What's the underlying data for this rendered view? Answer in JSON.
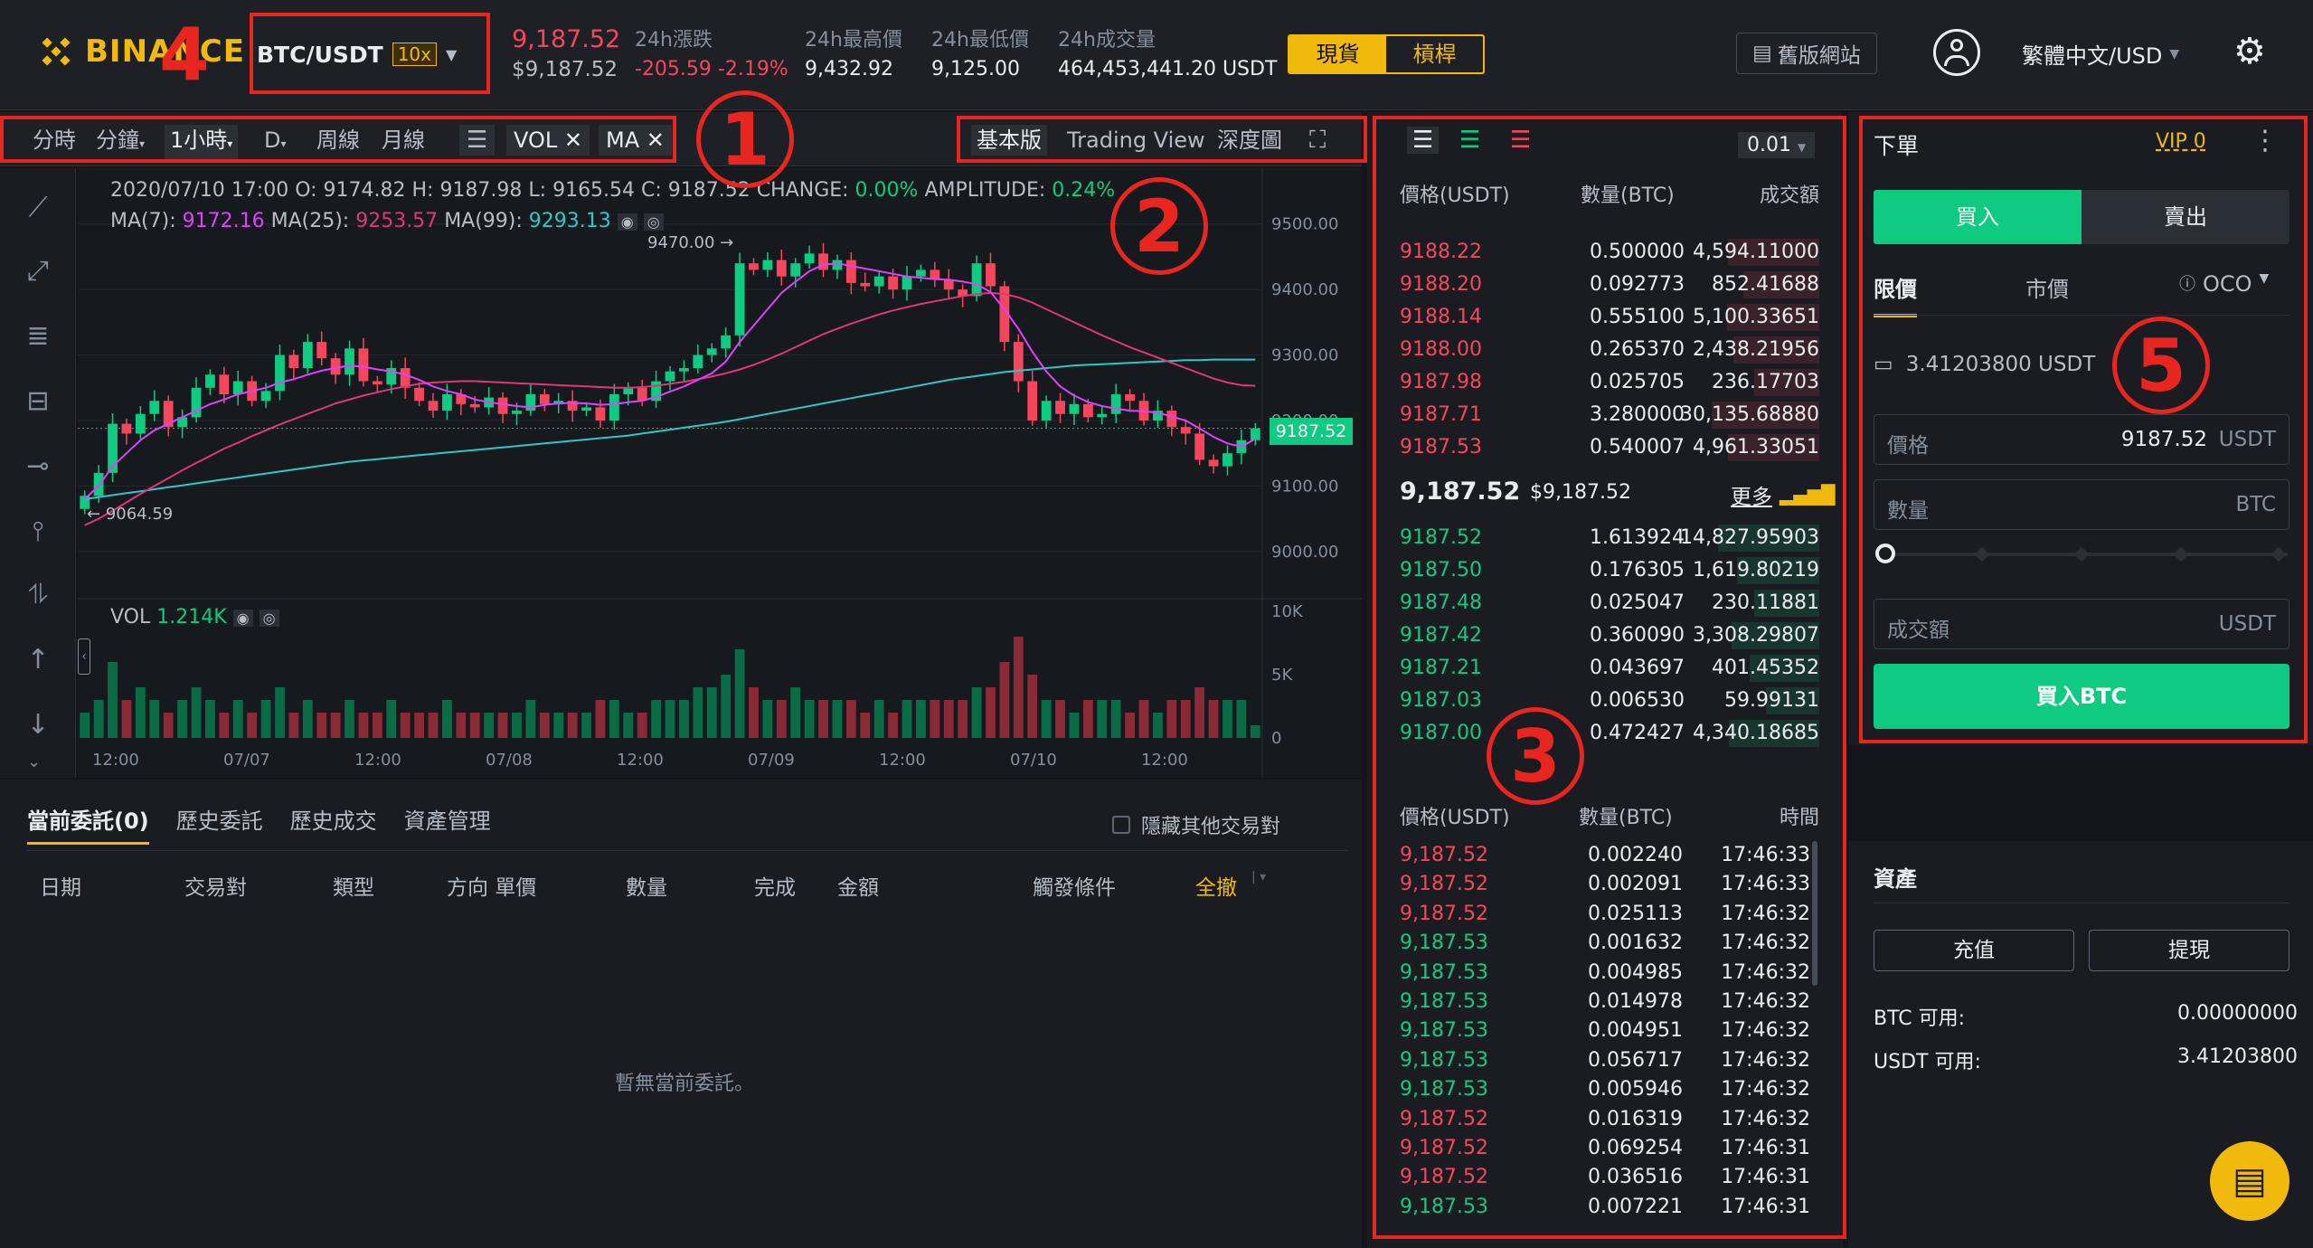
{
  "header": {
    "logo_text": "BINANCE",
    "pair": "BTC/USDT",
    "leverage": "10x",
    "last_price": "9,187.52",
    "last_price_usd": "$9,187.52",
    "change_label": "24h漲跌",
    "change_value": "-205.59 -2.19%",
    "high_label": "24h最高價",
    "high_value": "9,432.92",
    "low_label": "24h最低價",
    "low_value": "9,125.00",
    "volume_label": "24h成交量",
    "volume_value": "464,453,441.20 USDT",
    "spot_label": "現貨",
    "margin_label": "槓桿",
    "classic_label": "舊版網站",
    "language": "繁體中文/USD"
  },
  "chart_toolbar": {
    "items": [
      "分時",
      "分鐘",
      "1小時",
      "D",
      "周線",
      "月線"
    ],
    "vol_label": "VOL",
    "ma_label": "MA",
    "views": [
      "基本版",
      "Trading View",
      "深度圖"
    ]
  },
  "chart_info": {
    "ohlc_line": "2020/07/10 17:00  O: 9174.82  H: 9187.98  L: 9165.54  C: 9187.52",
    "change_text": "CHANGE: ",
    "change_val": "0.00%",
    "amp_text": "AMPLITUDE: ",
    "amp_val": "0.24%",
    "ma7_label": "MA(7):",
    "ma7_val": "9172.16",
    "ma25_label": "MA(25):",
    "ma25_val": "9253.57",
    "ma99_label": "MA(99):",
    "ma99_val": "9293.13",
    "high_marker": "9470.00",
    "low_marker": "9064.59",
    "current_price_tag": "9187.52",
    "vol_label": "VOL",
    "vol_val": "1.214K"
  },
  "chart_data": {
    "type": "candlestick",
    "y_ticks": [
      "9500.00",
      "9400.00",
      "9300.00",
      "9200.00",
      "9100.00",
      "9000.00"
    ],
    "ylim": [
      8950,
      9530
    ],
    "vol_ticks": [
      "10K",
      "5K",
      "0"
    ],
    "x_ticks": [
      "12:00",
      "07/07",
      "12:00",
      "07/08",
      "12:00",
      "07/09",
      "12:00",
      "07/10",
      "12:00"
    ],
    "closes": [
      9085,
      9120,
      9195,
      9180,
      9210,
      9230,
      9190,
      9205,
      9250,
      9270,
      9240,
      9260,
      9230,
      9245,
      9300,
      9280,
      9320,
      9295,
      9270,
      9310,
      9260,
      9255,
      9280,
      9250,
      9230,
      9215,
      9240,
      9225,
      9220,
      9235,
      9210,
      9215,
      9240,
      9225,
      9230,
      9215,
      9220,
      9200,
      9240,
      9250,
      9230,
      9260,
      9275,
      9280,
      9300,
      9310,
      9330,
      9440,
      9430,
      9445,
      9420,
      9440,
      9455,
      9430,
      9445,
      9410,
      9405,
      9420,
      9400,
      9420,
      9430,
      9415,
      9400,
      9390,
      9440,
      9405,
      9320,
      9260,
      9200,
      9230,
      9210,
      9225,
      9205,
      9210,
      9240,
      9230,
      9200,
      9215,
      9190,
      9180,
      9140,
      9130,
      9150,
      9170,
      9188
    ],
    "ma7": [
      9080,
      9100,
      9130,
      9150,
      9170,
      9185,
      9195,
      9205,
      9215,
      9225,
      9232,
      9240,
      9245,
      9250,
      9258,
      9263,
      9270,
      9276,
      9280,
      9284,
      9282,
      9278,
      9275,
      9270,
      9262,
      9252,
      9245,
      9240,
      9232,
      9228,
      9225,
      9222,
      9220,
      9224,
      9226,
      9227,
      9226,
      9224,
      9225,
      9228,
      9230,
      9236,
      9244,
      9252,
      9262,
      9272,
      9290,
      9320,
      9345,
      9370,
      9395,
      9412,
      9428,
      9438,
      9440,
      9436,
      9432,
      9428,
      9424,
      9420,
      9418,
      9416,
      9415,
      9412,
      9408,
      9396,
      9370,
      9340,
      9305,
      9275,
      9252,
      9238,
      9228,
      9222,
      9218,
      9215,
      9214,
      9212,
      9206,
      9200,
      9188,
      9175,
      9165,
      9160,
      9172
    ],
    "ma25": [
      9040,
      9050,
      9062,
      9075,
      9088,
      9100,
      9112,
      9124,
      9135,
      9146,
      9157,
      9166,
      9176,
      9185,
      9194,
      9202,
      9210,
      9218,
      9226,
      9232,
      9238,
      9243,
      9248,
      9252,
      9256,
      9258,
      9259,
      9260,
      9260,
      9259,
      9258,
      9257,
      9256,
      9255,
      9254,
      9253,
      9252,
      9251,
      9250,
      9250,
      9251,
      9253,
      9256,
      9259,
      9263,
      9267,
      9272,
      9278,
      9285,
      9293,
      9302,
      9312,
      9322,
      9332,
      9340,
      9348,
      9355,
      9362,
      9368,
      9373,
      9378,
      9382,
      9386,
      9390,
      9393,
      9395,
      9393,
      9388,
      9380,
      9370,
      9360,
      9350,
      9340,
      9330,
      9321,
      9312,
      9304,
      9296,
      9288,
      9280,
      9272,
      9264,
      9258,
      9254,
      9253
    ],
    "ma99": [
      9080,
      9083,
      9086,
      9089,
      9092,
      9095,
      9098,
      9101,
      9104,
      9107,
      9110,
      9113,
      9116,
      9119,
      9122,
      9125,
      9128,
      9131,
      9134,
      9137,
      9139,
      9141,
      9143,
      9145,
      9147,
      9149,
      9151,
      9153,
      9155,
      9157,
      9159,
      9161,
      9163,
      9165,
      9167,
      9169,
      9171,
      9173,
      9175,
      9177,
      9180,
      9183,
      9186,
      9189,
      9192,
      9195,
      9198,
      9202,
      9206,
      9210,
      9214,
      9218,
      9222,
      9226,
      9230,
      9234,
      9238,
      9242,
      9246,
      9250,
      9254,
      9258,
      9262,
      9265,
      9268,
      9271,
      9274,
      9276,
      9278,
      9280,
      9282,
      9284,
      9285,
      9286,
      9287,
      9288,
      9289,
      9290,
      9291,
      9292,
      9292,
      9293,
      9293,
      9293,
      9293
    ],
    "volumes": [
      2,
      3,
      6,
      3,
      4,
      3,
      2,
      3,
      4,
      3,
      2,
      3,
      2,
      3,
      4,
      2,
      3,
      2,
      2,
      3,
      2,
      2,
      3,
      2,
      2,
      2,
      3,
      2,
      2,
      2,
      2,
      2,
      3,
      2,
      2,
      2,
      2,
      3,
      3,
      2,
      2,
      3,
      3,
      3,
      4,
      4,
      5,
      7,
      4,
      3,
      3,
      4,
      3,
      3,
      3,
      3,
      2,
      3,
      2,
      3,
      3,
      3,
      3,
      3,
      4,
      4,
      6,
      8,
      5,
      3,
      3,
      2,
      3,
      3,
      3,
      2,
      3,
      2,
      3,
      3,
      4,
      3,
      3,
      3,
      1
    ]
  },
  "left_tools": [
    "trend-line-icon",
    "ray-icon",
    "fib-icon",
    "pattern-icon",
    "horizontal-line-icon",
    "vertical-line-icon",
    "path-icon",
    "arrow-up-icon",
    "arrow-down-icon"
  ],
  "orders": {
    "tabs": [
      "當前委託(0)",
      "歷史委託",
      "歷史成交",
      "資產管理"
    ],
    "hide_other": "隱藏其他交易對",
    "columns": [
      "日期",
      "交易對",
      "類型",
      "方向 單價",
      "數量",
      "完成",
      "金額",
      "觸發條件"
    ],
    "cancel_all": "全撤",
    "empty": "暫無當前委託。"
  },
  "orderbook": {
    "precision": "0.01",
    "headers": [
      "價格(USDT)",
      "數量(BTC)",
      "成交額"
    ],
    "asks": [
      [
        "9188.22",
        "0.500000",
        "4,594.11000"
      ],
      [
        "9188.20",
        "0.092773",
        "852.41688"
      ],
      [
        "9188.14",
        "0.555100",
        "5,100.33651"
      ],
      [
        "9188.00",
        "0.265370",
        "2,438.21956"
      ],
      [
        "9187.98",
        "0.025705",
        "236.17703"
      ],
      [
        "9187.71",
        "3.280000",
        "30,135.68880"
      ],
      [
        "9187.53",
        "0.540007",
        "4,961.33051"
      ]
    ],
    "mid_price": "9,187.52",
    "mid_usd": "$9,187.52",
    "more": "更多",
    "bids": [
      [
        "9187.52",
        "1.613924",
        "14,827.95903"
      ],
      [
        "9187.50",
        "0.176305",
        "1,619.80219"
      ],
      [
        "9187.48",
        "0.025047",
        "230.11881"
      ],
      [
        "9187.42",
        "0.360090",
        "3,308.29807"
      ],
      [
        "9187.21",
        "0.043697",
        "401.45352"
      ],
      [
        "9187.03",
        "0.006530",
        "59.99131"
      ],
      [
        "9187.00",
        "0.472427",
        "4,340.18685"
      ]
    ]
  },
  "trades": {
    "headers": [
      "價格(USDT)",
      "數量(BTC)",
      "時間"
    ],
    "rows": [
      [
        "9,187.52",
        "0.002240",
        "17:46:33",
        "sell"
      ],
      [
        "9,187.52",
        "0.002091",
        "17:46:33",
        "sell"
      ],
      [
        "9,187.52",
        "0.025113",
        "17:46:32",
        "sell"
      ],
      [
        "9,187.53",
        "0.001632",
        "17:46:32",
        "buy"
      ],
      [
        "9,187.53",
        "0.004985",
        "17:46:32",
        "buy"
      ],
      [
        "9,187.53",
        "0.014978",
        "17:46:32",
        "buy"
      ],
      [
        "9,187.53",
        "0.004951",
        "17:46:32",
        "buy"
      ],
      [
        "9,187.53",
        "0.056717",
        "17:46:32",
        "buy"
      ],
      [
        "9,187.53",
        "0.005946",
        "17:46:32",
        "buy"
      ],
      [
        "9,187.52",
        "0.016319",
        "17:46:32",
        "sell"
      ],
      [
        "9,187.52",
        "0.069254",
        "17:46:31",
        "sell"
      ],
      [
        "9,187.52",
        "0.036516",
        "17:46:31",
        "sell"
      ],
      [
        "9,187.53",
        "0.007221",
        "17:46:31",
        "buy"
      ]
    ]
  },
  "order_form": {
    "title": "下單",
    "vip": "VIP 0",
    "buy_tab": "買入",
    "sell_tab": "賣出",
    "type_tabs": [
      "限價",
      "市價",
      "OCO"
    ],
    "balance": "3.41203800 USDT",
    "price_label": "價格",
    "price_value": "9187.52",
    "price_unit": "USDT",
    "amount_label": "數量",
    "amount_unit": "BTC",
    "total_label": "成交額",
    "total_unit": "USDT",
    "submit": "買入BTC"
  },
  "assets": {
    "title": "資產",
    "deposit": "充值",
    "withdraw": "提現",
    "btc_label": "BTC 可用:",
    "btc_value": "0.00000000",
    "usdt_label": "USDT 可用:",
    "usdt_value": "3.41203800"
  },
  "annotations": [
    "1",
    "2",
    "3",
    "4",
    "5"
  ],
  "colors": {
    "accent": "#f0b90b",
    "up": "#0ecb81",
    "down": "#f6465d",
    "box": "#e8261f"
  }
}
